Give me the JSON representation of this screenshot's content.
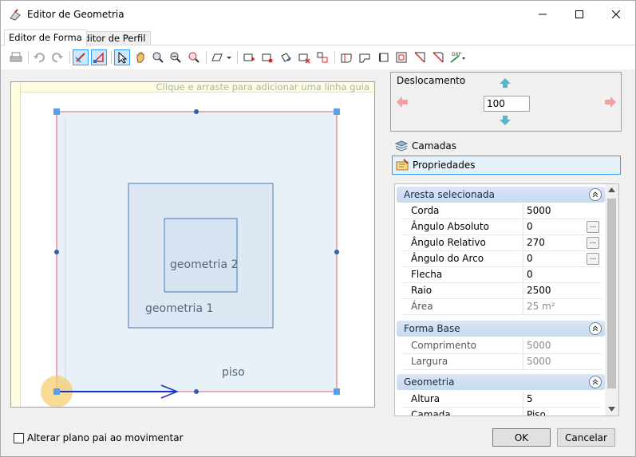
{
  "window": {
    "title": "Editor de Geometria",
    "minimize_icon": "minimize-icon",
    "maximize_icon": "maximize-icon",
    "close_icon": "close-icon"
  },
  "tabs": [
    {
      "label": "Editor de Forma",
      "active": true
    },
    {
      "label": "Editor de Perfil",
      "active": false
    }
  ],
  "toolbar": {
    "icons": [
      "print-icon",
      "undo-icon",
      "redo-icon",
      "edit-edge-icon",
      "edit-node-icon",
      "select-icon",
      "pan-icon",
      "zoom-in-icon",
      "zoom-window-icon",
      "zoom-all-icon",
      "shape-dropdown-icon",
      "add-node-icon",
      "move-node-icon",
      "rotate-icon",
      "delete-node-icon",
      "split-icon",
      "arc-icon",
      "fillet-icon",
      "chamfer-icon",
      "offset-icon",
      "mirror-icon",
      "trim-icon",
      "dxf-import-icon"
    ]
  },
  "canvas": {
    "guide_hint": "Clique e arraste para adicionar uma linha guia",
    "labels": {
      "geometria2": "geometria 2",
      "geometria1": "geometria 1",
      "piso": "piso"
    },
    "colors": {
      "outer_border": "#e06070",
      "fill": "#e8f0f8",
      "inner_border": "#4a7ab5",
      "handle": "#2f78d4",
      "arrow": "#1a2fd0",
      "origin_marker": "#f5cf70"
    }
  },
  "deslocamento": {
    "label": "Deslocamento",
    "value": "100"
  },
  "sections": {
    "camadas": "Camadas",
    "propriedades": "Propriedades"
  },
  "properties": {
    "groups": [
      {
        "title": "Aresta selecionada",
        "rows": [
          {
            "name": "Corda",
            "value": "5000"
          },
          {
            "name": "Ângulo Absoluto",
            "value": "0"
          },
          {
            "name": "Ângulo Relativo",
            "value": "270"
          },
          {
            "name": "Ângulo do Arco",
            "value": "0"
          },
          {
            "name": "Flecha",
            "value": "0"
          },
          {
            "name": "Raio",
            "value": "2500"
          },
          {
            "name": "Área",
            "value": "25 m²"
          }
        ]
      },
      {
        "title": "Forma Base",
        "rows": [
          {
            "name": "Comprimento",
            "value": "5000"
          },
          {
            "name": "Largura",
            "value": "5000"
          }
        ]
      },
      {
        "title": "Geometria",
        "rows": [
          {
            "name": "Altura",
            "value": "5"
          },
          {
            "name": "Camada",
            "value": "Piso"
          }
        ]
      }
    ]
  },
  "footer": {
    "checkbox_label": "Alterar plano pai ao movimentar",
    "ok": "OK",
    "cancel": "Cancelar"
  }
}
